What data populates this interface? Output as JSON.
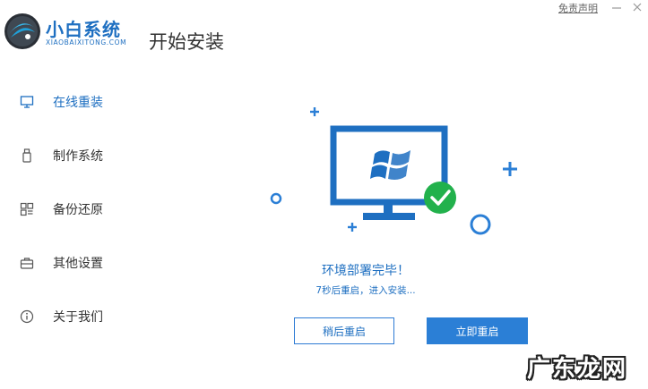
{
  "app": {
    "name": "小白系统",
    "subtitle": "XIAOBAIXITONG.COM",
    "page_title": "开始安装"
  },
  "window": {
    "disclaimer_link": "免责声明",
    "minimize_icon": "minimize-icon",
    "close_icon": "close-icon"
  },
  "sidebar": {
    "items": [
      {
        "label": "在线重装",
        "icon": "monitor-icon",
        "active": true
      },
      {
        "label": "制作系统",
        "icon": "usb-drive-icon",
        "active": false
      },
      {
        "label": "备份还原",
        "icon": "backup-grid-icon",
        "active": false
      },
      {
        "label": "其他设置",
        "icon": "toolbox-icon",
        "active": false
      },
      {
        "label": "关于我们",
        "icon": "info-icon",
        "active": false
      }
    ]
  },
  "status": {
    "title": "环境部署完毕！",
    "subtitle": "7秒后重启，进入安装..."
  },
  "buttons": {
    "restart_later": "稍后重启",
    "restart_now": "立即重启"
  },
  "watermark": "广东龙网",
  "colors": {
    "accent": "#1e6fc1",
    "button_primary": "#2b7fd6",
    "check_badge": "#22b14c"
  }
}
